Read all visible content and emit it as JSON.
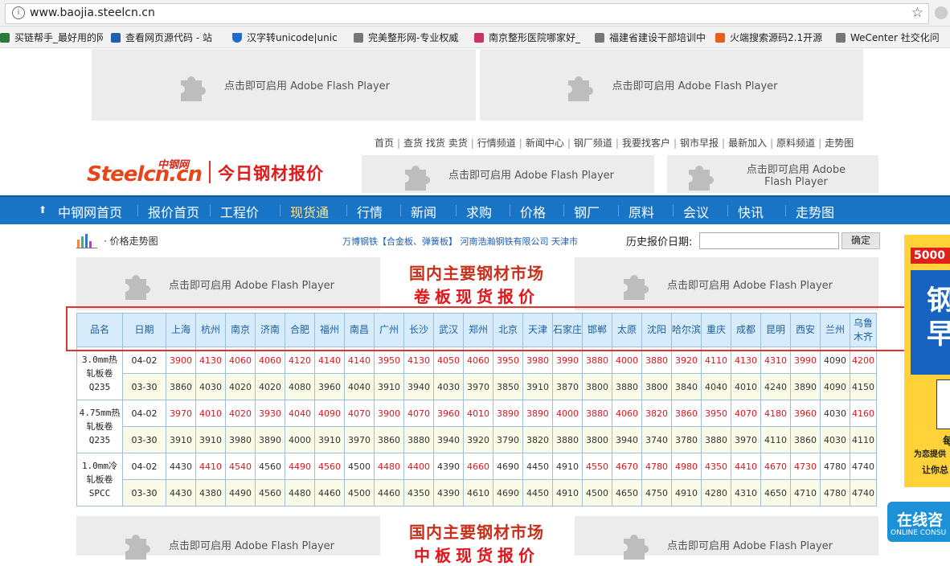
{
  "browser": {
    "url": "www.baojia.steelcn.cn",
    "bookmarks": [
      {
        "label": "买链帮手_最好用的网",
        "icon": "cube-icon",
        "color": "#2a7a3a"
      },
      {
        "label": "查看网页源代码 - 站",
        "icon": "page-icon",
        "color": "#1e5fb0"
      },
      {
        "label": "汉字转unicode|unic",
        "icon": "shield-icon",
        "color": "#1e6ad0"
      },
      {
        "label": "完美整形网-专业权威",
        "icon": "doc-icon",
        "color": "#777"
      },
      {
        "label": "南京整形医院哪家好_",
        "icon": "cross-icon",
        "color": "#d0306a"
      },
      {
        "label": "福建省建设干部培训中",
        "icon": "doc-icon",
        "color": "#777"
      },
      {
        "label": "火端搜索源码2.1开源",
        "icon": "fire-icon",
        "color": "#e8601c"
      },
      {
        "label": "WeCenter 社交化问",
        "icon": "doc-icon",
        "color": "#777"
      }
    ]
  },
  "flash_text": "点击即可启用 Adobe Flash Player",
  "top_links": [
    "首页",
    "查货 找货 卖货",
    "行情频道",
    "新闻中心",
    "钢厂频道",
    "我要找客户",
    "钢市早报",
    "最新加入",
    "原料频道",
    "走势图"
  ],
  "logo": {
    "cn": "中钢网",
    "en": "Steelcn.cn",
    "slogan": "今日钢材报价"
  },
  "nav": {
    "items": [
      "中钢网首页",
      "报价首页",
      "工程价",
      "现货通",
      "行情",
      "新闻",
      "求购",
      "价格",
      "钢厂",
      "原料",
      "会议",
      "快讯",
      "走势图"
    ],
    "active": "现货通"
  },
  "subbar": {
    "trend_label": "· 价格走势图",
    "marquee": "万博钢铁【合金板、弹簧板】  河南浩瀚钢铁有限公司  天津市",
    "history_label": "历史报价日期:",
    "history_value": "",
    "confirm_label": "确定"
  },
  "banners": [
    {
      "line1": "国内主要钢材市场",
      "line2": "卷板现货报价"
    },
    {
      "line1": "国内主要钢材市场",
      "line2": "中板现货报价"
    }
  ],
  "table": {
    "headers": [
      "品名",
      "日期",
      "上海",
      "杭州",
      "南京",
      "济南",
      "合肥",
      "福州",
      "南昌",
      "广州",
      "长沙",
      "武汉",
      "郑州",
      "北京",
      "天津",
      "石家庄",
      "邯郸",
      "太原",
      "沈阳",
      "哈尔滨",
      "重庆",
      "成都",
      "昆明",
      "西安",
      "兰州",
      "乌鲁木齐"
    ],
    "products": [
      {
        "name": [
          "3.0mm热",
          "轧板卷",
          "Q235"
        ],
        "rows": [
          {
            "date": "04-02",
            "values": [
              "3900",
              "4130",
              "4060",
              "4060",
              "4120",
              "4140",
              "4140",
              "3950",
              "4130",
              "4050",
              "4060",
              "3950",
              "3980",
              "3990",
              "3880",
              "4000",
              "3880",
              "3920",
              "4110",
              "4130",
              "4310",
              "3990",
              "4090",
              "4200"
            ]
          },
          {
            "date": "03-30",
            "values": [
              "3860",
              "4030",
              "4020",
              "4020",
              "4080",
              "3960",
              "4040",
              "3910",
              "3940",
              "4030",
              "3970",
              "3850",
              "3910",
              "3870",
              "3800",
              "3880",
              "3800",
              "3840",
              "4040",
              "4010",
              "4240",
              "3890",
              "4090",
              "4150"
            ]
          }
        ]
      },
      {
        "name": [
          "4.75mm热",
          "轧板卷",
          "Q235"
        ],
        "rows": [
          {
            "date": "04-02",
            "values": [
              "3970",
              "4010",
              "4020",
              "3930",
              "4040",
              "4090",
              "4070",
              "3900",
              "4070",
              "3960",
              "4010",
              "3890",
              "3890",
              "4000",
              "3880",
              "4060",
              "3820",
              "3860",
              "3950",
              "4070",
              "4180",
              "3960",
              "4030",
              "4160"
            ]
          },
          {
            "date": "03-30",
            "values": [
              "3910",
              "3910",
              "3980",
              "3890",
              "4000",
              "3910",
              "3970",
              "3860",
              "3880",
              "3940",
              "3920",
              "3790",
              "3820",
              "3880",
              "3800",
              "3940",
              "3740",
              "3780",
              "3880",
              "3970",
              "4110",
              "3860",
              "4030",
              "4110"
            ]
          }
        ]
      },
      {
        "name": [
          "1.0mm冷",
          "轧板卷",
          "SPCC"
        ],
        "rows": [
          {
            "date": "04-02",
            "values": [
              "4430",
              "4410",
              "4540",
              "4560",
              "4490",
              "4560",
              "4500",
              "4480",
              "4400",
              "4390",
              "4660",
              "4690",
              "4450",
              "4910",
              "4550",
              "4670",
              "4780",
              "4980",
              "4350",
              "4410",
              "4670",
              "4730",
              "4780",
              "4740"
            ]
          },
          {
            "date": "03-30",
            "values": [
              "4430",
              "4380",
              "4490",
              "4560",
              "4480",
              "4460",
              "4500",
              "4460",
              "4350",
              "4390",
              "4610",
              "4690",
              "4450",
              "4910",
              "4500",
              "4650",
              "4750",
              "4910",
              "4280",
              "4310",
              "4650",
              "4710",
              "4780",
              "4740"
            ]
          }
        ]
      }
    ]
  },
  "right_ad": {
    "lines": [
      "5000",
      "钢",
      "早",
      "每",
      "为恋提供",
      "让你总"
    ]
  },
  "online": {
    "title": "在线咨",
    "sub": "ONLINE CONSU"
  }
}
